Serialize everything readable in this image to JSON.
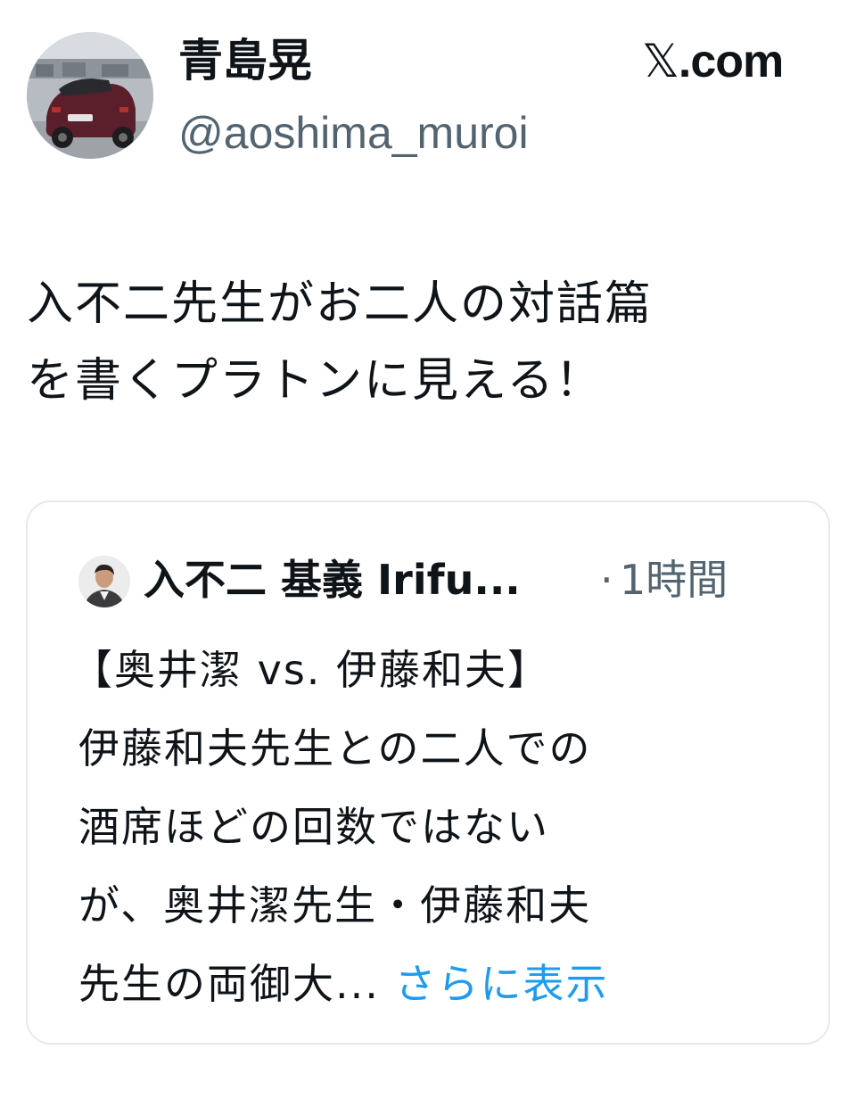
{
  "tweet": {
    "author": {
      "display_name": "青島晃",
      "handle": "@aoshima_muroi",
      "avatar_icon": "car-photo-avatar"
    },
    "brand": {
      "logo": "𝕏",
      "domain": ".com"
    },
    "text": "入不二先生がお二人の対話篇\nを書くプラトンに見える！"
  },
  "quote": {
    "author_name": "入不二 基義 Irifu...",
    "separator": "·",
    "time": "1時間",
    "avatar_icon": "person-portrait-avatar",
    "lines": [
      "【奥井潔 vs. 伊藤和夫】",
      "伊藤和夫先生との二人での",
      "酒席ほどの回数ではない",
      "が、奥井潔先生・伊藤和夫",
      "先生の両御大..."
    ],
    "more_label": "さらに表示"
  },
  "colors": {
    "text": "#0f1419",
    "secondary": "#536471",
    "link": "#1d9bf0",
    "border": "#e6e9eb"
  }
}
